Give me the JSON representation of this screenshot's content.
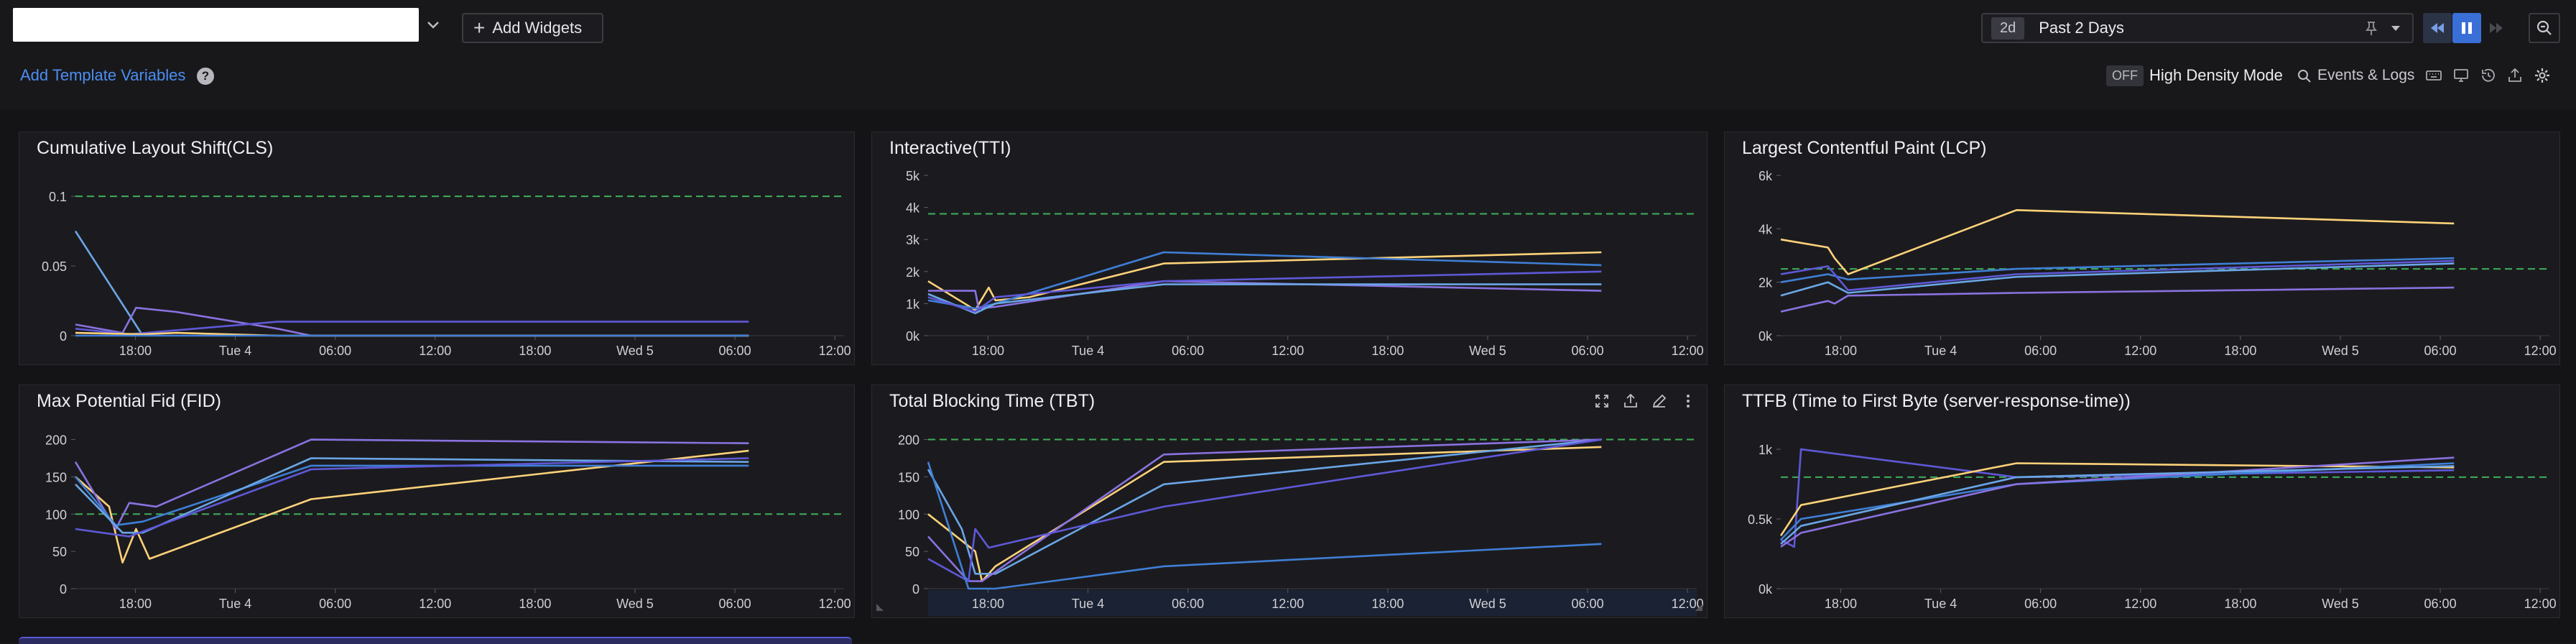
{
  "toolbar": {
    "dashboard_title": "",
    "add_widgets_label": "Add Widgets",
    "time_badge": "2d",
    "time_label": "Past 2 Days"
  },
  "subbar": {
    "template_vars_label": "Add Template Variables",
    "help_icon": "?",
    "hdm_toggle": "OFF",
    "hdm_label": "High Density Mode",
    "events_label": "Events & Logs"
  },
  "colors": {
    "yellow": "#ffd27a",
    "blue": "#3f7fd6",
    "purple": "#8a72e0",
    "lightblue": "#6aa6e6",
    "violet": "#5f58d8",
    "threshold": "#3fae5a"
  },
  "x_ticks": [
    "18:00",
    "Tue 4",
    "06:00",
    "12:00",
    "18:00",
    "Wed 5",
    "06:00",
    "12:00"
  ],
  "widgets": [
    {
      "title": "Cumulative Layout Shift(CLS)",
      "chart_data": {
        "type": "line",
        "y_ticks": [
          "0.1",
          "0.05",
          "0"
        ],
        "y_values": [
          0.1,
          0.05,
          0
        ],
        "ylim": [
          0,
          0.115
        ],
        "threshold": 0.1,
        "series": [
          {
            "color": "lightblue",
            "points": [
              [
                0,
                0.075
              ],
              [
                0.1,
                0.0
              ]
            ]
          },
          {
            "color": "purple",
            "points": [
              [
                0,
                0.008
              ],
              [
                0.07,
                0.002
              ],
              [
                0.09,
                0.02
              ],
              [
                0.15,
                0.017
              ],
              [
                0.3,
                0.005
              ],
              [
                0.35,
                0.0
              ],
              [
                1,
                0.0
              ]
            ]
          },
          {
            "color": "violet",
            "points": [
              [
                0,
                0.005
              ],
              [
                0.08,
                0.001
              ],
              [
                0.3,
                0.01
              ],
              [
                1,
                0.01
              ]
            ]
          },
          {
            "color": "yellow",
            "points": [
              [
                0,
                0.002
              ],
              [
                0.1,
                0.001
              ],
              [
                0.15,
                0.002
              ],
              [
                0.3,
                0.0
              ],
              [
                1,
                0.0
              ]
            ]
          },
          {
            "color": "blue",
            "points": [
              [
                0,
                0.0
              ],
              [
                1,
                0.0
              ]
            ]
          }
        ]
      }
    },
    {
      "title": "Interactive(TTI)",
      "chart_data": {
        "type": "line",
        "y_ticks": [
          "5k",
          "4k",
          "3k",
          "2k",
          "1k",
          "0k"
        ],
        "y_values": [
          5000,
          4000,
          3000,
          2000,
          1000,
          0
        ],
        "ylim": [
          0,
          5000
        ],
        "threshold": 3800,
        "series": [
          {
            "color": "yellow",
            "points": [
              [
                0,
                1700
              ],
              [
                0.07,
                800
              ],
              [
                0.09,
                1500
              ],
              [
                0.1,
                1100
              ],
              [
                0.15,
                1200
              ],
              [
                0.35,
                2250
              ],
              [
                1,
                2600
              ]
            ]
          },
          {
            "color": "blue",
            "points": [
              [
                0,
                1100
              ],
              [
                0.07,
                850
              ],
              [
                0.1,
                1000
              ],
              [
                0.35,
                2600
              ],
              [
                1,
                2200
              ]
            ]
          },
          {
            "color": "purple",
            "points": [
              [
                0,
                1400
              ],
              [
                0.07,
                1400
              ],
              [
                0.075,
                850
              ],
              [
                0.1,
                900
              ],
              [
                0.35,
                1700
              ],
              [
                1,
                1400
              ]
            ]
          },
          {
            "color": "lightblue",
            "points": [
              [
                0,
                1300
              ],
              [
                0.07,
                700
              ],
              [
                0.1,
                1000
              ],
              [
                0.35,
                1600
              ],
              [
                1,
                1600
              ]
            ]
          },
          {
            "color": "violet",
            "points": [
              [
                0,
                1200
              ],
              [
                0.07,
                750
              ],
              [
                0.1,
                1200
              ],
              [
                0.35,
                1700
              ],
              [
                1,
                2000
              ]
            ]
          }
        ]
      }
    },
    {
      "title": "Largest Contentful Paint (LCP)",
      "chart_data": {
        "type": "line",
        "y_ticks": [
          "6k",
          "4k",
          "2k",
          "0k"
        ],
        "y_values": [
          6000,
          4000,
          2000,
          0
        ],
        "ylim": [
          0,
          6000
        ],
        "threshold": 2500,
        "series": [
          {
            "color": "yellow",
            "points": [
              [
                0,
                3600
              ],
              [
                0.07,
                3300
              ],
              [
                0.08,
                2900
              ],
              [
                0.1,
                2300
              ],
              [
                0.35,
                4700
              ],
              [
                1,
                4200
              ]
            ]
          },
          {
            "color": "blue",
            "points": [
              [
                0,
                2000
              ],
              [
                0.07,
                2300
              ],
              [
                0.1,
                2100
              ],
              [
                0.35,
                2500
              ],
              [
                1,
                2900
              ]
            ]
          },
          {
            "color": "violet",
            "points": [
              [
                0,
                2300
              ],
              [
                0.07,
                2600
              ],
              [
                0.1,
                1700
              ],
              [
                0.35,
                2300
              ],
              [
                1,
                2800
              ]
            ]
          },
          {
            "color": "lightblue",
            "points": [
              [
                0,
                1500
              ],
              [
                0.07,
                2000
              ],
              [
                0.1,
                1600
              ],
              [
                0.35,
                2200
              ],
              [
                1,
                2700
              ]
            ]
          },
          {
            "color": "purple",
            "points": [
              [
                0,
                900
              ],
              [
                0.07,
                1300
              ],
              [
                0.08,
                1200
              ],
              [
                0.1,
                1500
              ],
              [
                0.35,
                1600
              ],
              [
                1,
                1800
              ]
            ]
          }
        ]
      }
    },
    {
      "title": "Max Potential Fid (FID)",
      "chart_data": {
        "type": "line",
        "y_ticks": [
          "200",
          "150",
          "100",
          "50",
          "0"
        ],
        "y_values": [
          200,
          150,
          100,
          50,
          0
        ],
        "ylim": [
          0,
          215
        ],
        "threshold": 100,
        "series": [
          {
            "color": "yellow",
            "points": [
              [
                0,
                150
              ],
              [
                0.05,
                110
              ],
              [
                0.07,
                35
              ],
              [
                0.09,
                80
              ],
              [
                0.11,
                40
              ],
              [
                0.35,
                120
              ],
              [
                1,
                185
              ]
            ]
          },
          {
            "color": "purple",
            "points": [
              [
                0,
                170
              ],
              [
                0.06,
                80
              ],
              [
                0.08,
                115
              ],
              [
                0.12,
                110
              ],
              [
                0.35,
                200
              ],
              [
                1,
                195
              ]
            ]
          },
          {
            "color": "blue",
            "points": [
              [
                0,
                150
              ],
              [
                0.06,
                85
              ],
              [
                0.1,
                90
              ],
              [
                0.35,
                165
              ],
              [
                1,
                165
              ]
            ]
          },
          {
            "color": "lightblue",
            "points": [
              [
                0,
                140
              ],
              [
                0.07,
                75
              ],
              [
                0.1,
                75
              ],
              [
                0.35,
                175
              ],
              [
                1,
                170
              ]
            ]
          },
          {
            "color": "violet",
            "points": [
              [
                0,
                80
              ],
              [
                0.08,
                70
              ],
              [
                0.35,
                160
              ],
              [
                1,
                175
              ]
            ]
          }
        ]
      }
    },
    {
      "title": "Total Blocking Time (TBT)",
      "chart_data": {
        "type": "line",
        "y_ticks": [
          "200",
          "150",
          "100",
          "50",
          "0"
        ],
        "y_values": [
          200,
          150,
          100,
          50,
          0
        ],
        "ylim": [
          0,
          215
        ],
        "threshold": 200,
        "series": [
          {
            "color": "yellow",
            "points": [
              [
                0,
                100
              ],
              [
                0.07,
                50
              ],
              [
                0.08,
                10
              ],
              [
                0.1,
                30
              ],
              [
                0.35,
                170
              ],
              [
                1,
                190
              ]
            ]
          },
          {
            "color": "lightblue",
            "points": [
              [
                0,
                160
              ],
              [
                0.05,
                80
              ],
              [
                0.07,
                20
              ],
              [
                0.1,
                20
              ],
              [
                0.35,
                140
              ],
              [
                1,
                200
              ]
            ]
          },
          {
            "color": "purple",
            "points": [
              [
                0,
                70
              ],
              [
                0.06,
                10
              ],
              [
                0.08,
                10
              ],
              [
                0.35,
                180
              ],
              [
                1,
                200
              ]
            ]
          },
          {
            "color": "violet",
            "points": [
              [
                0,
                40
              ],
              [
                0.06,
                10
              ],
              [
                0.07,
                80
              ],
              [
                0.09,
                55
              ],
              [
                0.35,
                110
              ],
              [
                1,
                200
              ]
            ]
          },
          {
            "color": "blue",
            "points": [
              [
                0,
                170
              ],
              [
                0.06,
                0
              ],
              [
                0.1,
                0
              ],
              [
                0.35,
                30
              ],
              [
                1,
                60
              ]
            ]
          }
        ]
      }
    },
    {
      "title": "TTFB (Time to First Byte (server-response-time))",
      "chart_data": {
        "type": "line",
        "y_ticks": [
          "1k",
          "0.5k",
          "0k"
        ],
        "y_values": [
          1000,
          500,
          0
        ],
        "ylim": [
          0,
          1150
        ],
        "threshold": 800,
        "series": [
          {
            "color": "violet",
            "points": [
              [
                0,
                350
              ],
              [
                0.02,
                300
              ],
              [
                0.03,
                1000
              ],
              [
                0.35,
                800
              ],
              [
                1,
                850
              ]
            ]
          },
          {
            "color": "yellow",
            "points": [
              [
                0,
                380
              ],
              [
                0.03,
                600
              ],
              [
                0.35,
                900
              ],
              [
                1,
                870
              ]
            ]
          },
          {
            "color": "blue",
            "points": [
              [
                0,
                350
              ],
              [
                0.03,
                500
              ],
              [
                0.35,
                750
              ],
              [
                1,
                900
              ]
            ]
          },
          {
            "color": "purple",
            "points": [
              [
                0,
                300
              ],
              [
                0.03,
                400
              ],
              [
                0.35,
                750
              ],
              [
                1,
                940
              ]
            ]
          },
          {
            "color": "lightblue",
            "points": [
              [
                0,
                320
              ],
              [
                0.03,
                450
              ],
              [
                0.35,
                800
              ],
              [
                1,
                880
              ]
            ]
          }
        ]
      }
    }
  ]
}
